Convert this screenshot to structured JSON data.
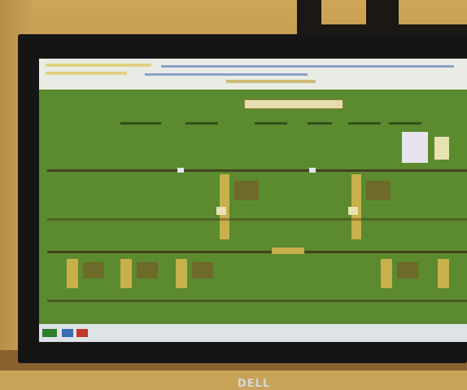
{
  "scene": {
    "description_kind": "photo of a monitor displaying a green schematic application",
    "brand_text": "DELL",
    "colors": {
      "screen_bg": "#5b8a2f",
      "wall": "#c8a35a",
      "bezel": "#151515",
      "toolbar": "#e9ece4",
      "taskbar": "#dfe3e8"
    }
  }
}
